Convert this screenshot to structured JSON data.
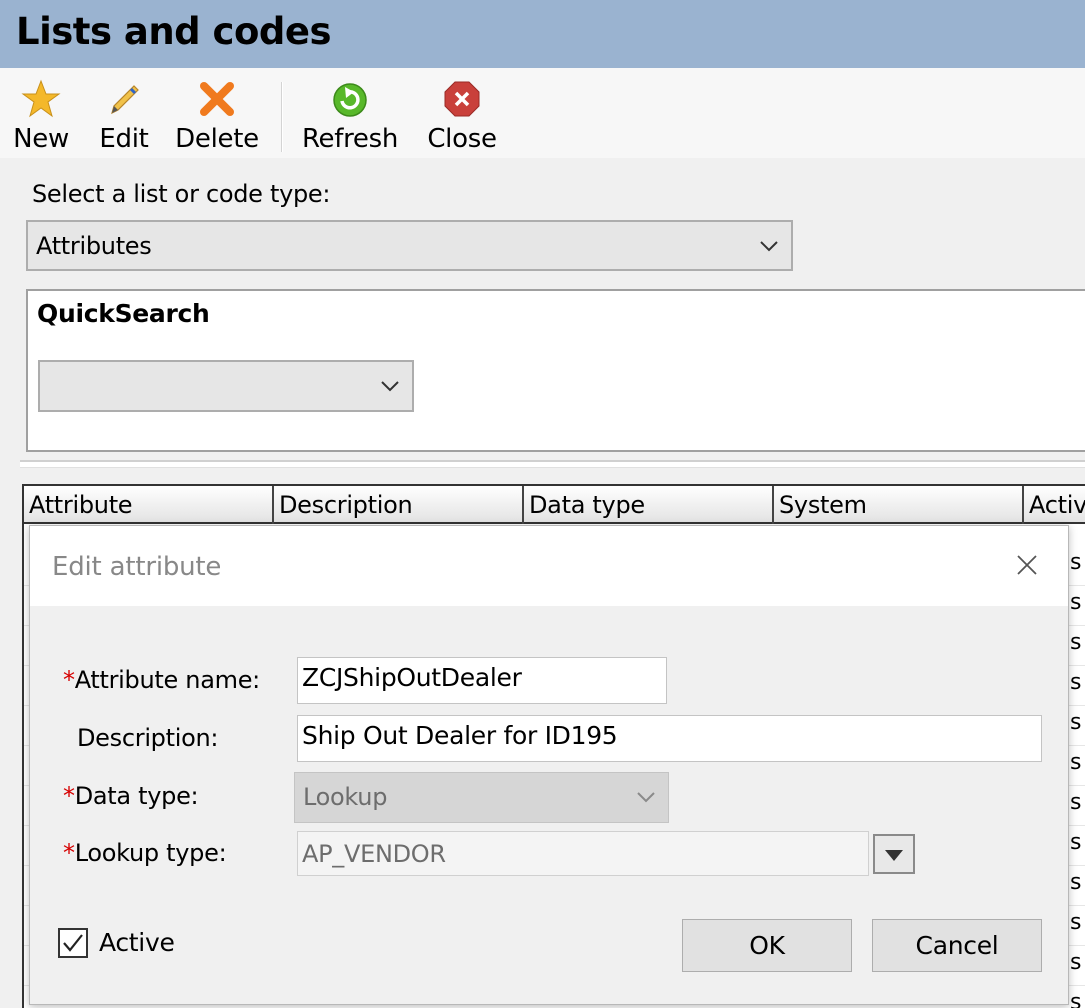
{
  "window": {
    "title": "Lists and codes"
  },
  "toolbar": {
    "new": {
      "label": "New",
      "icon": "star-icon"
    },
    "edit": {
      "label": "Edit",
      "icon": "pencil-icon"
    },
    "delete": {
      "label": "Delete",
      "icon": "x-icon"
    },
    "refresh": {
      "label": "Refresh",
      "icon": "refresh-icon"
    },
    "close": {
      "label": "Close",
      "icon": "close-icon"
    }
  },
  "list_selector": {
    "label": "Select a list or code type:",
    "value": "Attributes"
  },
  "quick_search": {
    "title": "QuickSearch",
    "value": ""
  },
  "grid": {
    "columns": [
      "Attribute",
      "Description",
      "Data type",
      "System",
      "Activ"
    ],
    "row_tail_values": [
      "s",
      "s",
      "s",
      "s",
      "s",
      "s",
      "s",
      "s",
      "s",
      "s",
      "s",
      "s"
    ]
  },
  "dialog": {
    "title": "Edit attribute",
    "fields": {
      "attribute_name": {
        "label": "Attribute name:",
        "value": "ZCJShipOutDealer",
        "required": true
      },
      "description": {
        "label": "Description:",
        "value": "Ship Out Dealer for ID195",
        "required": false
      },
      "data_type": {
        "label": "Data type:",
        "value": "Lookup",
        "required": true
      },
      "lookup_type": {
        "label": "Lookup type:",
        "value": "AP_VENDOR",
        "required": true
      }
    },
    "active": {
      "label": "Active",
      "checked": true
    },
    "ok_label": "OK",
    "cancel_label": "Cancel",
    "required_marker": "*"
  },
  "colors": {
    "titlebar": "#9ab3d0",
    "required": "#d60000",
    "star": "#f4b82a",
    "delete": "#f07a1e",
    "refresh": "#58b82a",
    "close": "#c9403b"
  }
}
